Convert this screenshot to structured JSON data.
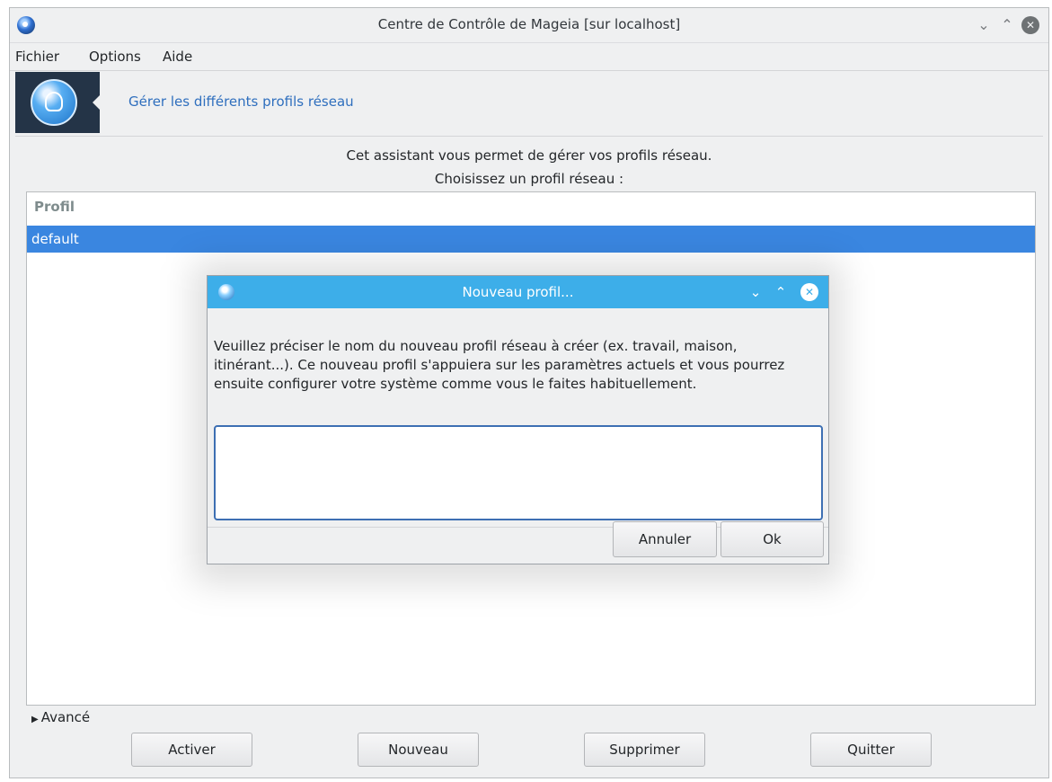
{
  "window": {
    "title": "Centre de Contrôle de Mageia [sur localhost]",
    "controls": {
      "minimize": "⌄",
      "maximize": "⌃",
      "close": "✕"
    }
  },
  "menu": {
    "items": [
      "Fichier",
      "Options",
      "Aide"
    ]
  },
  "banner": {
    "title": "Gérer les différents profils réseau",
    "icon": "network-profile-icon"
  },
  "intro": {
    "line1": "Cet assistant vous permet de gérer vos profils réseau.",
    "line2": "Choisissez un profil réseau :"
  },
  "profiles": {
    "header": "Profil",
    "rows": [
      {
        "name": "default",
        "selected": true
      }
    ]
  },
  "advanced": {
    "arrow": "▶",
    "label": "Avancé"
  },
  "buttons": {
    "activate": "Activer",
    "new": "Nouveau",
    "delete": "Supprimer",
    "quit": "Quitter"
  },
  "dialog": {
    "title": "Nouveau profil...",
    "controls": {
      "minimize": "⌄",
      "maximize": "⌃",
      "close": "✕"
    },
    "message": "Veuillez préciser le nom du nouveau profil réseau à créer (ex. travail, maison, itinérant...). Ce nouveau profil s'appuiera sur les paramètres actuels et vous pourrez ensuite configurer votre système comme vous le faites habituellement.",
    "input_value": "",
    "cancel_label": "Annuler",
    "ok_label": "Ok"
  },
  "colors": {
    "accent": "#3daee9",
    "selection": "#3a86e0",
    "link_text": "#2f6fbe",
    "banner_bg": "#243447"
  }
}
